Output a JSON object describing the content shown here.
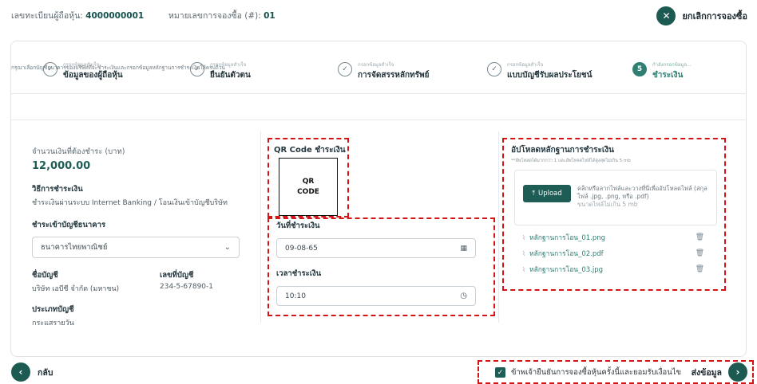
{
  "header": {
    "holder_reg_label": "เลขทะเบียนผู้ถือหุ้น:",
    "holder_reg_value": "4000000001",
    "booking_label": "หมายเลขการจองซื้อ (#):",
    "booking_value": "01",
    "cancel_label": "ยกเลิกการจองซื้อ",
    "cancel_icon": "close-icon"
  },
  "steps": [
    {
      "sub": "กรอกข้อมูลสำเร็จ",
      "title": "ข้อมูลของผู้ถือหุ้น",
      "status": "done"
    },
    {
      "sub": "กรอกข้อมูลสำเร็จ",
      "title": "ยืนยันตัวตน",
      "status": "done"
    },
    {
      "sub": "กรอกข้อมูลสำเร็จ",
      "title": "การจัดสรรหลักทรัพย์",
      "status": "done"
    },
    {
      "sub": "กรอกข้อมูลสำเร็จ",
      "title": "แบบบัญชีรับผลประโยชน์",
      "status": "done"
    },
    {
      "sub": "กำลังกรอกข้อมูล...",
      "title": "ชำระเงิน",
      "status": "active",
      "number": "5"
    }
  ],
  "instruction": "กรุณาเลือกบัญชีธนาคารของบริษัทที่จะชำระเงินและกรอกข้อมูลหลักฐานการชำระเงินให้ครบถ้วน",
  "payment": {
    "amount_label": "จำนวนเงินที่ต้องชำระ (บาท)",
    "amount_value": "12,000.00",
    "method_label": "วิธีการชำระเงิน",
    "method_value": "ชำระเงินผ่านระบบ Internet Banking / โอนเงินเข้าบัญชีบริษัท",
    "bank_label": "ชำระเข้าบัญชีธนาคาร",
    "bank_selected": "ธนาคารไทยพาณิชย์",
    "account_name_label": "ชื่อบัญชี",
    "account_name_value": "บริษัท เอบีซี จำกัด (มหาชน)",
    "account_no_label": "เลขที่บัญชี",
    "account_no_value": "234-5-67890-1",
    "account_type_label": "ประเภทบัญชี",
    "account_type_value": "กระแสรายวัน"
  },
  "qr": {
    "title": "QR Code ชำระเงิน",
    "box_line1": "QR",
    "box_line2": "CODE"
  },
  "datetime": {
    "date_label": "วันที่ชำระเงิน",
    "date_value": "09-08-65",
    "time_label": "เวลาชำระเงิน",
    "time_value": "10:10"
  },
  "upload": {
    "title": "อัปโหลดหลักฐานการชำระเงิน",
    "hint": "**อัพโหลดได้มากกว่า 1 และอัพโหลดไฟล์ได้สูงสุดไม่เกิน 5 mb",
    "button_label": "Upload",
    "desc": "คลิกหรือลากไฟล์และวางที่นี่เพื่ออัปโหลดไฟล์ (สกุลไฟล์ .jpg, .png, หรือ .pdf)",
    "size_note": "ขนาดไฟล์ไม่เกิน 5 mb",
    "files": [
      "หลักฐานการโอน_01.png",
      "หลักฐานการโอน_02.pdf",
      "หลักฐานการโอน_03.jpg"
    ]
  },
  "footer": {
    "back_label": "กลับ",
    "agree_label": "ข้าพเจ้ายืนยันการจองซื้อหุ้นครั้งนี้และยอมรับเงื่อนไข",
    "submit_label": "ส่งข้อมูล"
  },
  "colors": {
    "brand": "#1d5d55",
    "accent": "#2f7f73",
    "highlight": "#d41414"
  }
}
